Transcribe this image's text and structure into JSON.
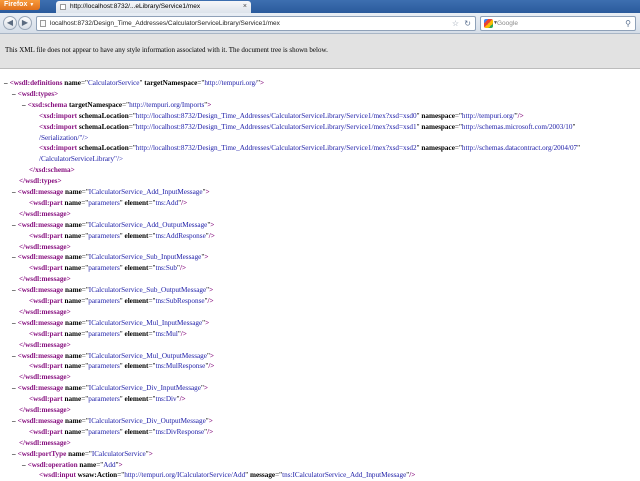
{
  "browser": {
    "app_button": "Firefox",
    "tab_title": "http://localhost:8732/...eLibrary/Service1/mex",
    "url": "localhost:8732/Design_Time_Addresses/CalculatorServiceLibrary/Service1/mex",
    "search_placeholder": "Google"
  },
  "notice": "This XML file does not appear to have any style information associated with it. The document tree is shown below.",
  "xml_lines": [
    {
      "indent": 0,
      "toggle": "–",
      "tag": "<wsdl:definitions",
      "attrs": [
        [
          "name",
          "CalculatorService"
        ],
        [
          "targetNamespace",
          "http://tempuri.org/"
        ]
      ],
      "end": ">"
    },
    {
      "indent": 1,
      "toggle": "–",
      "tag": "<wsdl:types",
      "attrs": [],
      "end": ">"
    },
    {
      "indent": 2,
      "toggle": "–",
      "tag": "<xsd:schema",
      "attrs": [
        [
          "targetNamespace",
          "http://tempuri.org/Imports"
        ]
      ],
      "end": ">"
    },
    {
      "indent": 3,
      "toggle": "",
      "tag": "<xsd:import",
      "attrs": [
        [
          "schemaLocation",
          "http://localhost:8732/Design_Time_Addresses/CalculatorServiceLibrary/Service1/mex?xsd=xsd0"
        ],
        [
          "namespace",
          "http://tempuri.org/"
        ]
      ],
      "end": "/>"
    },
    {
      "indent": 3,
      "toggle": "",
      "tag": "<xsd:import",
      "attrs": [
        [
          "schemaLocation",
          "http://localhost:8732/Design_Time_Addresses/CalculatorServiceLibrary/Service1/mex?xsd=xsd1"
        ],
        [
          "namespace",
          "http://schemas.microsoft.com/2003/10"
        ]
      ],
      "end": ""
    },
    {
      "indent": 3,
      "toggle": "",
      "cont": true,
      "text": "/Serialization/\"/>"
    },
    {
      "indent": 3,
      "toggle": "",
      "tag": "<xsd:import",
      "attrs": [
        [
          "schemaLocation",
          "http://localhost:8732/Design_Time_Addresses/CalculatorServiceLibrary/Service1/mex?xsd=xsd2"
        ],
        [
          "namespace",
          "http://schemas.datacontract.org/2004/07"
        ]
      ],
      "end": ""
    },
    {
      "indent": 3,
      "toggle": "",
      "cont": true,
      "text": "/CalculatorServiceLibrary\"/>"
    },
    {
      "indent": 2,
      "toggle": "",
      "tag": "</xsd:schema",
      "attrs": [],
      "end": ">"
    },
    {
      "indent": 1,
      "toggle": "",
      "tag": "</wsdl:types",
      "attrs": [],
      "end": ">"
    },
    {
      "indent": 1,
      "toggle": "–",
      "tag": "<wsdl:message",
      "attrs": [
        [
          "name",
          "ICalculatorService_Add_InputMessage"
        ]
      ],
      "end": ">"
    },
    {
      "indent": 2,
      "toggle": "",
      "tag": "<wsdl:part",
      "attrs": [
        [
          "name",
          "parameters"
        ],
        [
          "element",
          "tns:Add"
        ]
      ],
      "end": "/>"
    },
    {
      "indent": 1,
      "toggle": "",
      "tag": "</wsdl:message",
      "attrs": [],
      "end": ">"
    },
    {
      "indent": 1,
      "toggle": "–",
      "tag": "<wsdl:message",
      "attrs": [
        [
          "name",
          "ICalculatorService_Add_OutputMessage"
        ]
      ],
      "end": ">"
    },
    {
      "indent": 2,
      "toggle": "",
      "tag": "<wsdl:part",
      "attrs": [
        [
          "name",
          "parameters"
        ],
        [
          "element",
          "tns:AddResponse"
        ]
      ],
      "end": "/>"
    },
    {
      "indent": 1,
      "toggle": "",
      "tag": "</wsdl:message",
      "attrs": [],
      "end": ">"
    },
    {
      "indent": 1,
      "toggle": "–",
      "tag": "<wsdl:message",
      "attrs": [
        [
          "name",
          "ICalculatorService_Sub_InputMessage"
        ]
      ],
      "end": ">"
    },
    {
      "indent": 2,
      "toggle": "",
      "tag": "<wsdl:part",
      "attrs": [
        [
          "name",
          "parameters"
        ],
        [
          "element",
          "tns:Sub"
        ]
      ],
      "end": "/>"
    },
    {
      "indent": 1,
      "toggle": "",
      "tag": "</wsdl:message",
      "attrs": [],
      "end": ">"
    },
    {
      "indent": 1,
      "toggle": "–",
      "tag": "<wsdl:message",
      "attrs": [
        [
          "name",
          "ICalculatorService_Sub_OutputMessage"
        ]
      ],
      "end": ">"
    },
    {
      "indent": 2,
      "toggle": "",
      "tag": "<wsdl:part",
      "attrs": [
        [
          "name",
          "parameters"
        ],
        [
          "element",
          "tns:SubResponse"
        ]
      ],
      "end": "/>"
    },
    {
      "indent": 1,
      "toggle": "",
      "tag": "</wsdl:message",
      "attrs": [],
      "end": ">"
    },
    {
      "indent": 1,
      "toggle": "–",
      "tag": "<wsdl:message",
      "attrs": [
        [
          "name",
          "ICalculatorService_Mul_InputMessage"
        ]
      ],
      "end": ">"
    },
    {
      "indent": 2,
      "toggle": "",
      "tag": "<wsdl:part",
      "attrs": [
        [
          "name",
          "parameters"
        ],
        [
          "element",
          "tns:Mul"
        ]
      ],
      "end": "/>"
    },
    {
      "indent": 1,
      "toggle": "",
      "tag": "</wsdl:message",
      "attrs": [],
      "end": ">"
    },
    {
      "indent": 1,
      "toggle": "–",
      "tag": "<wsdl:message",
      "attrs": [
        [
          "name",
          "ICalculatorService_Mul_OutputMessage"
        ]
      ],
      "end": ">"
    },
    {
      "indent": 2,
      "toggle": "",
      "tag": "<wsdl:part",
      "attrs": [
        [
          "name",
          "parameters"
        ],
        [
          "element",
          "tns:MulResponse"
        ]
      ],
      "end": "/>"
    },
    {
      "indent": 1,
      "toggle": "",
      "tag": "</wsdl:message",
      "attrs": [],
      "end": ">"
    },
    {
      "indent": 1,
      "toggle": "–",
      "tag": "<wsdl:message",
      "attrs": [
        [
          "name",
          "ICalculatorService_Div_InputMessage"
        ]
      ],
      "end": ">"
    },
    {
      "indent": 2,
      "toggle": "",
      "tag": "<wsdl:part",
      "attrs": [
        [
          "name",
          "parameters"
        ],
        [
          "element",
          "tns:Div"
        ]
      ],
      "end": "/>"
    },
    {
      "indent": 1,
      "toggle": "",
      "tag": "</wsdl:message",
      "attrs": [],
      "end": ">"
    },
    {
      "indent": 1,
      "toggle": "–",
      "tag": "<wsdl:message",
      "attrs": [
        [
          "name",
          "ICalculatorService_Div_OutputMessage"
        ]
      ],
      "end": ">"
    },
    {
      "indent": 2,
      "toggle": "",
      "tag": "<wsdl:part",
      "attrs": [
        [
          "name",
          "parameters"
        ],
        [
          "element",
          "tns:DivResponse"
        ]
      ],
      "end": "/>"
    },
    {
      "indent": 1,
      "toggle": "",
      "tag": "</wsdl:message",
      "attrs": [],
      "end": ">"
    },
    {
      "indent": 1,
      "toggle": "–",
      "tag": "<wsdl:portType",
      "attrs": [
        [
          "name",
          "ICalculatorService"
        ]
      ],
      "end": ">"
    },
    {
      "indent": 2,
      "toggle": "–",
      "tag": "<wsdl:operation",
      "attrs": [
        [
          "name",
          "Add"
        ]
      ],
      "end": ">"
    },
    {
      "indent": 3,
      "toggle": "",
      "tag": "<wsdl:input",
      "attrs": [
        [
          "wsaw:Action",
          "http://tempuri.org/ICalculatorService/Add"
        ],
        [
          "message",
          "tns:ICalculatorService_Add_InputMessage"
        ]
      ],
      "end": "/>"
    }
  ]
}
